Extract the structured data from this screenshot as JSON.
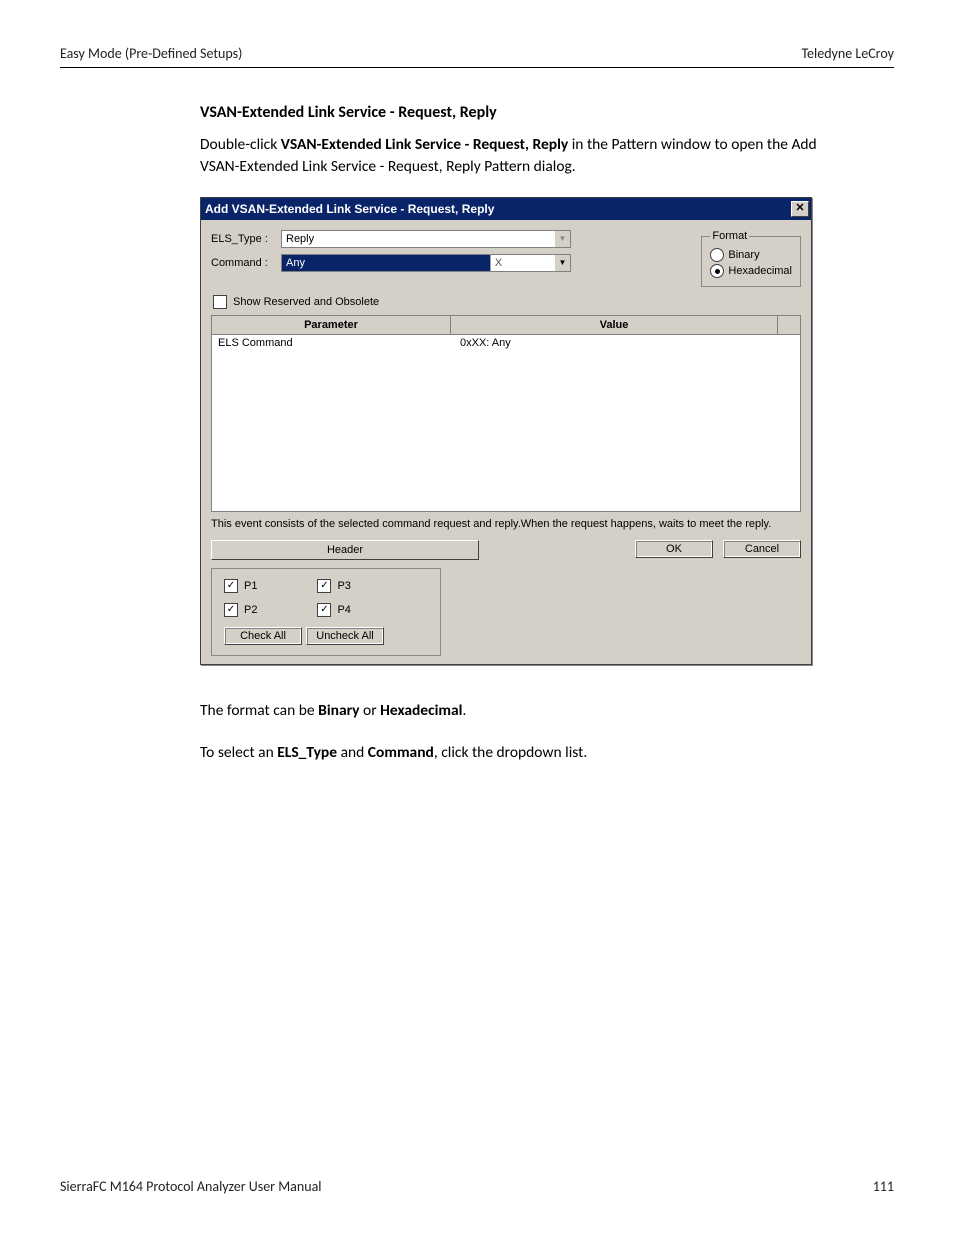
{
  "header": {
    "left": "Easy Mode (Pre-Defined Setups)",
    "right": "Teledyne LeCroy"
  },
  "section_title": "VSAN-Extended Link Service - Request, Reply",
  "intro_prefix": "Double-click ",
  "intro_bold": "VSAN-Extended Link Service - Request, Reply",
  "intro_suffix": " in the Pattern window to open the Add VSAN-Extended Link Service - Request, Reply Pattern dialog.",
  "dialog": {
    "title": "Add VSAN-Extended Link Service - Request, Reply",
    "close_glyph": "✕",
    "labels": {
      "els_type": "ELS_Type :",
      "command": "Command :",
      "show_reserved": "Show Reserved and Obsolete",
      "format_legend": "Format",
      "binary": "Binary",
      "hex": "Hexadecimal",
      "header_btn": "Header",
      "ok": "OK",
      "cancel": "Cancel",
      "check_all": "Check All",
      "uncheck_all": "Uncheck All"
    },
    "els_type_value": "Reply",
    "command_value": "Any",
    "clear_glyph": "X",
    "grid": {
      "col_parameter": "Parameter",
      "col_value": "Value",
      "rows": [
        {
          "param": "ELS Command",
          "value": "0xXX: Any"
        }
      ]
    },
    "note": "This event consists of the selected command request and reply.When the request happens, waits to meet the reply.",
    "ports": {
      "p1": "P1",
      "p2": "P2",
      "p3": "P3",
      "p4": "P4"
    }
  },
  "after1_prefix": "The format can be ",
  "after1_b1": "Binary",
  "after1_mid": " or ",
  "after1_b2": "Hexadecimal",
  "after1_suffix": ".",
  "after2_prefix": "To select an ",
  "after2_b1": "ELS_Type",
  "after2_mid": " and ",
  "after2_b2": "Command",
  "after2_suffix": ", click the dropdown list.",
  "footer": {
    "left": "SierraFC M164 Protocol Analyzer User Manual",
    "page": "111"
  }
}
